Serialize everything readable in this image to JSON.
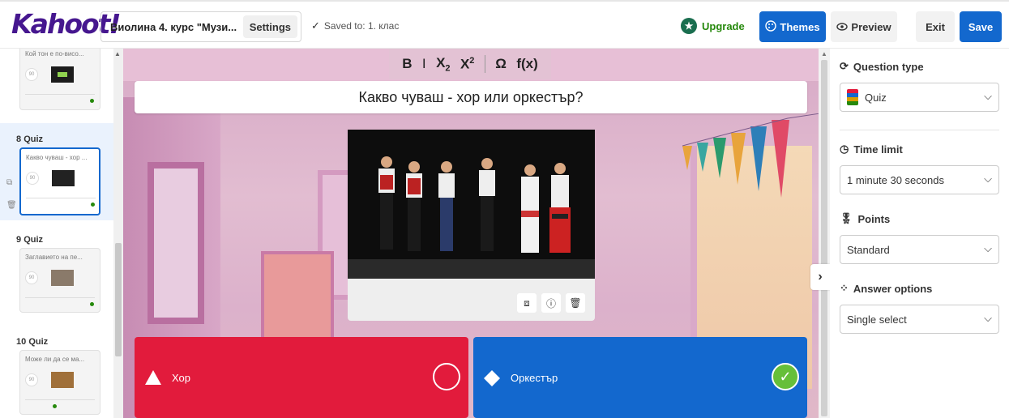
{
  "app": {
    "logo": "Kahoot!"
  },
  "header": {
    "title": "Виолина 4. курс \"Музи...",
    "settings_label": "Settings",
    "saved_text": "Saved to: 1. клас",
    "upgrade_label": "Upgrade",
    "themes_label": "Themes",
    "preview_label": "Preview",
    "exit_label": "Exit",
    "save_label": "Save"
  },
  "sidebar": {
    "slides": [
      {
        "number": "",
        "type": "",
        "question": "Кой тон е по-висо...",
        "timer": "90"
      },
      {
        "number": "8",
        "type": "Quiz",
        "question": "Какво чуваш - хор ...",
        "timer": "90"
      },
      {
        "number": "9",
        "type": "Quiz",
        "question": "Заглавието на пе...",
        "timer": "90"
      },
      {
        "number": "10",
        "type": "Quiz",
        "question": "Може ли да се ма...",
        "timer": "90"
      }
    ]
  },
  "editor": {
    "toolbar": {
      "bold": "B",
      "italic": "I",
      "sub": "X",
      "sup": "X",
      "omega": "Ω",
      "fx": "f(x)"
    },
    "question": "Какво чуваш - хор или оркестър?",
    "answers": [
      {
        "text": "Хор",
        "color": "#e21b3c",
        "shape": "triangle",
        "correct": false
      },
      {
        "text": "Оркестър",
        "color": "#1368ce",
        "shape": "diamond",
        "correct": true
      }
    ]
  },
  "settings_panel": {
    "question_type": {
      "label": "Question type",
      "value": "Quiz"
    },
    "time_limit": {
      "label": "Time limit",
      "value": "1 minute 30 seconds"
    },
    "points": {
      "label": "Points",
      "value": "Standard"
    },
    "answer_options": {
      "label": "Answer options",
      "value": "Single select"
    }
  },
  "colors": {
    "brand": "#46178f",
    "primary_button": "#1368ce",
    "upgrade": "#26890c"
  }
}
